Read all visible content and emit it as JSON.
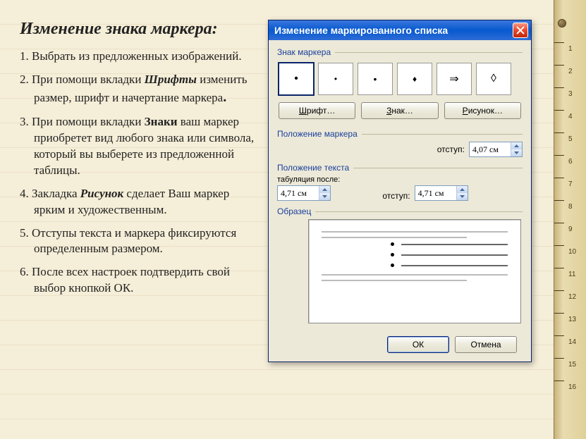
{
  "page": {
    "title": "Изменение знака маркера:",
    "items": [
      {
        "num": "1.",
        "text_before": " Выбрать из предложенных изображений.",
        "bold": "",
        "text_after": ""
      },
      {
        "num": "2.",
        "text_before": " При помощи вкладки ",
        "bold_it": "Шрифты",
        "text_after": " изменить размер, шрифт и начертание маркера",
        "tail": "."
      },
      {
        "num": "3.",
        "text_before": " При помощи вкладки ",
        "bold": "Знаки",
        "text_after": " ваш маркер приобретет вид любого знака или символа, который вы выберете из предложенной таблицы."
      },
      {
        "num": "4.",
        "text_before": " Закладка ",
        "bold_it": "Рисунок",
        "text_after": " сделает Ваш маркер ярким и художественным."
      },
      {
        "num": "5.",
        "text_before": " Отступы текста и маркера фиксируются определенным размером.",
        "bold": "",
        "text_after": ""
      },
      {
        "num": "6.",
        "text_before": " После всех настроек подтвердить свой выбор кнопкой ОК.",
        "bold": "",
        "text_after": ""
      }
    ]
  },
  "dialog": {
    "title": "Изменение маркированного списка",
    "groups": {
      "marker_char": "Знак маркера",
      "marker_pos": "Положение маркера",
      "text_pos": "Положение текста",
      "preview": "Образец"
    },
    "markers": [
      {
        "glyph": "•",
        "selected": true,
        "size": "lg"
      },
      {
        "glyph": "•",
        "selected": false,
        "size": "sm"
      },
      {
        "glyph": "•",
        "selected": false,
        "size": "md"
      },
      {
        "glyph": "♦",
        "selected": false,
        "size": "sm"
      },
      {
        "glyph": "⇒",
        "selected": false,
        "size": "lg"
      },
      {
        "glyph": "◊",
        "selected": false,
        "size": "lg"
      }
    ],
    "buttons": {
      "font": {
        "und": "Ш",
        "rest": "рифт…"
      },
      "char": {
        "und": "З",
        "rest": "нак…"
      },
      "pic": {
        "und": "Р",
        "rest": "исунок…"
      }
    },
    "fields": {
      "indent_label": "отступ:",
      "marker_indent_value": "4,07 см",
      "tab_after_label": "табуляция после:",
      "tab_after_value": "4,71 см",
      "text_indent_value": "4,71 см"
    },
    "footer": {
      "ok": "ОК",
      "cancel": "Отмена"
    }
  },
  "ruler": {
    "numbers": [
      "1",
      "2",
      "3",
      "4",
      "5",
      "6",
      "7",
      "8",
      "9",
      "10",
      "11",
      "12",
      "13",
      "14",
      "15",
      "16"
    ]
  }
}
